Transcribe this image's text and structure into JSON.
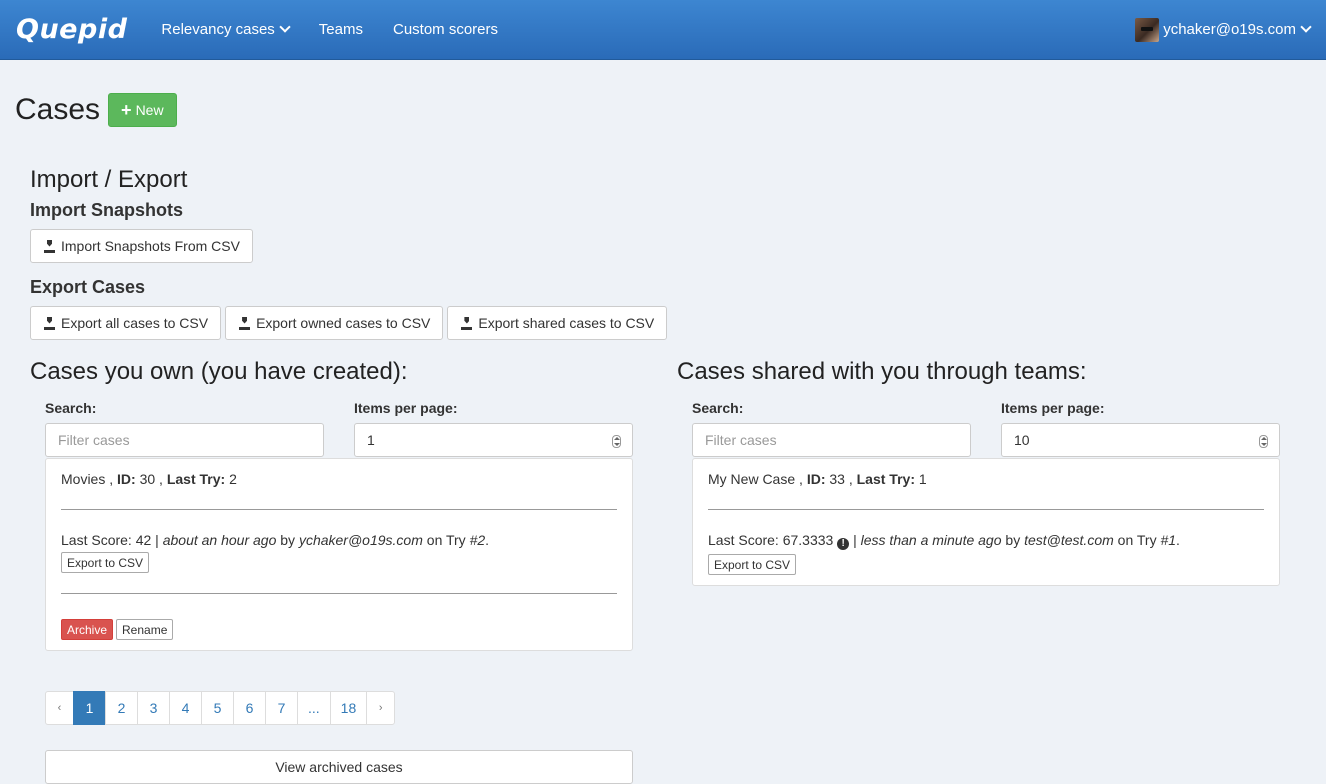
{
  "nav": {
    "brand": "Quepid",
    "items": [
      "Relevancy cases",
      "Teams",
      "Custom scorers"
    ],
    "user": "ychaker@o19s.com",
    "icons": {
      "dropdown": "chevron-down-icon",
      "avatar": "user-avatar"
    }
  },
  "header": {
    "title": "Cases",
    "new_label": "New"
  },
  "import_export": {
    "title": "Import / Export",
    "import_title": "Import Snapshots",
    "import_button": "Import Snapshots From CSV",
    "export_title": "Export Cases",
    "export_buttons": [
      "Export all cases to CSV",
      "Export owned cases to CSV",
      "Export shared cases to CSV"
    ]
  },
  "owned": {
    "title": "Cases you own (you have created):",
    "search_label": "Search:",
    "search_placeholder": "Filter cases",
    "per_page_label": "Items per page:",
    "per_page_value": "1",
    "case": {
      "name": "Movies",
      "id_label": "ID:",
      "id": "30",
      "last_try_label": "Last Try:",
      "last_try": "2",
      "score_label": "Last Score:",
      "score": "42",
      "when": "about an hour ago",
      "by": "by",
      "user": "ychaker@o19s.com",
      "on_try": "on Try",
      "try_ref": "#2",
      "export_label": "Export to CSV",
      "archive_label": "Archive",
      "rename_label": "Rename"
    },
    "pagination": {
      "prev": "‹",
      "pages": [
        "1",
        "2",
        "3",
        "4",
        "5",
        "6",
        "7",
        "...",
        "18"
      ],
      "next": "›",
      "current": "1"
    },
    "view_archived": "View archived cases"
  },
  "shared": {
    "title": "Cases shared with you through teams:",
    "search_label": "Search:",
    "search_placeholder": "Filter cases",
    "per_page_label": "Items per page:",
    "per_page_value": "10",
    "case": {
      "name": "My New Case",
      "id_label": "ID:",
      "id": "33",
      "last_try_label": "Last Try:",
      "last_try": "1",
      "score_label": "Last Score:",
      "score": "67.3333",
      "warning_glyph": "!",
      "when": "less than a minute ago",
      "by": "by",
      "user": "test@test.com",
      "on_try": "on Try",
      "try_ref": "#1",
      "export_label": "Export to CSV"
    }
  },
  "colors": {
    "navbar": "#2f75c4",
    "success": "#5cb85c",
    "danger": "#d9534f",
    "link": "#337ab7"
  }
}
